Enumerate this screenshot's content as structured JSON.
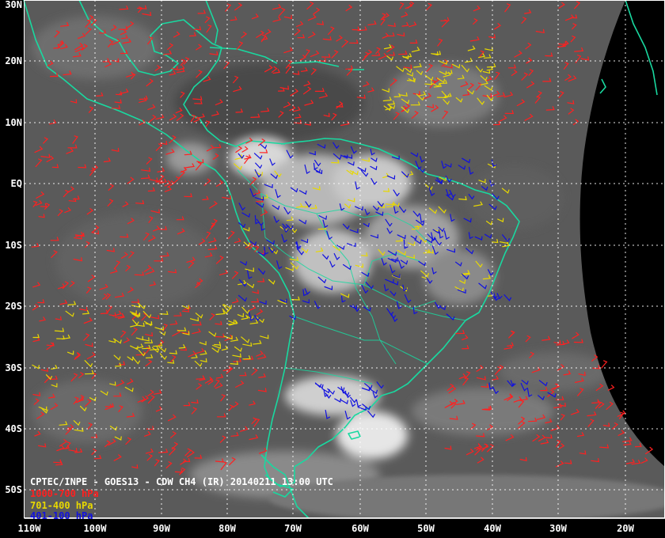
{
  "title": "CPTEC/INPE - GOES13 - CDW CH4 (IR) 20140211 13:00 UTC",
  "legend": [
    {
      "label": "1000-700 hPa",
      "color": "#ff2020"
    },
    {
      "label": "701-400 hPa",
      "color": "#e8d800"
    },
    {
      "label": "401-100 hPa",
      "color": "#1010e0"
    }
  ],
  "lat_labels": [
    "30N",
    "20N",
    "10N",
    "EQ",
    "10S",
    "20S",
    "30S",
    "40S",
    "50S"
  ],
  "lon_labels": [
    "110W",
    "100W",
    "90W",
    "80W",
    "70W",
    "60W",
    "50W",
    "40W",
    "30W",
    "20W"
  ],
  "colors": {
    "coast": "#19d9a0",
    "grid": "#ffffff",
    "space": "#000000",
    "cloud_dark": "#505050",
    "cloud_bright": "#e6e6e6"
  }
}
